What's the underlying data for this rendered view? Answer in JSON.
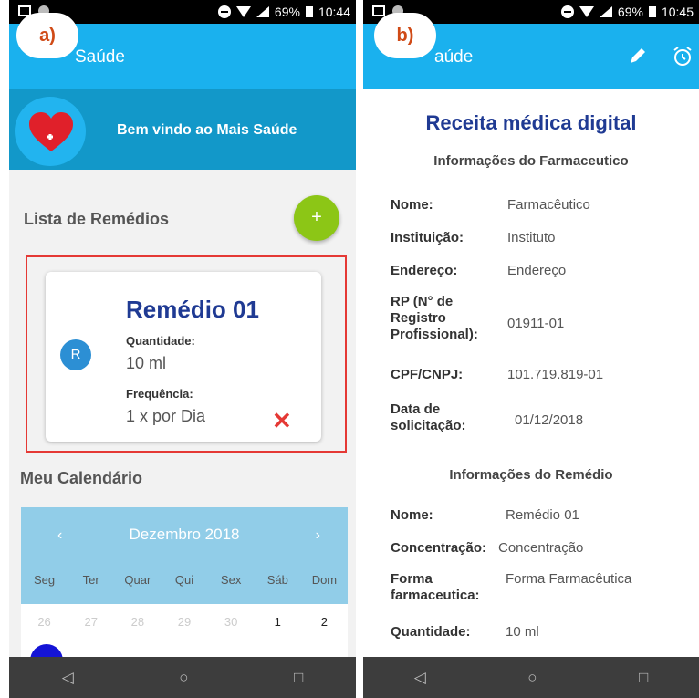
{
  "panel_a": {
    "badge": "a)",
    "status": {
      "battery": "69%",
      "time": "10:44"
    },
    "app_title": "Saúde",
    "welcome": "Bem vindo ao Mais Saúde",
    "list_title": "Lista de Remédios",
    "fab_label": "+",
    "card": {
      "avatar": "R",
      "name": "Remédio 01",
      "quantity_label": "Quantidade:",
      "quantity_value": "10 ml",
      "frequency_label": "Frequência:",
      "frequency_value": "1 x por Dia",
      "delete_icon": "✕"
    },
    "calendar_title": "Meu Calendário",
    "calendar": {
      "prev": "‹",
      "next": "›",
      "month": "Dezembro  2018",
      "weekdays": [
        "Seg",
        "Ter",
        "Quar",
        "Qui",
        "Sex",
        "Sáb",
        "Dom"
      ],
      "days": [
        "26",
        "27",
        "28",
        "29",
        "30",
        "1",
        "2"
      ]
    }
  },
  "panel_b": {
    "badge": "b)",
    "status": {
      "battery": "69%",
      "time": "10:45"
    },
    "app_title": "aúde",
    "doc_title": "Receita médica digital",
    "pharm_section": "Informações do Farmaceutico",
    "pharm_rows": [
      {
        "label": "Nome:",
        "value": "Farmacêutico"
      },
      {
        "label": "Instituição:",
        "value": "Instituto"
      },
      {
        "label": "Endereço:",
        "value": "Endereço"
      },
      {
        "label": "RP (N° de Registro Profissional):",
        "value": "01911-01"
      },
      {
        "label": "CPF/CNPJ:",
        "value": "101.719.819-01"
      },
      {
        "label": "Data de solicitação:",
        "value": "01/12/2018"
      }
    ],
    "med_section": "Informações do Remédio",
    "med_rows": [
      {
        "label": "Nome:",
        "value": "Remédio 01"
      },
      {
        "label": "Concentração:",
        "value": "Concentração"
      },
      {
        "label": "Forma farmaceutica:",
        "value": "Forma Farmacêutica"
      },
      {
        "label": "Quantidade:",
        "value": "10 ml"
      }
    ]
  },
  "nav": {
    "back": "◁",
    "home": "○",
    "recent": "□"
  },
  "icons": [
    "edit-icon",
    "alarm-icon",
    "heart-icon"
  ]
}
